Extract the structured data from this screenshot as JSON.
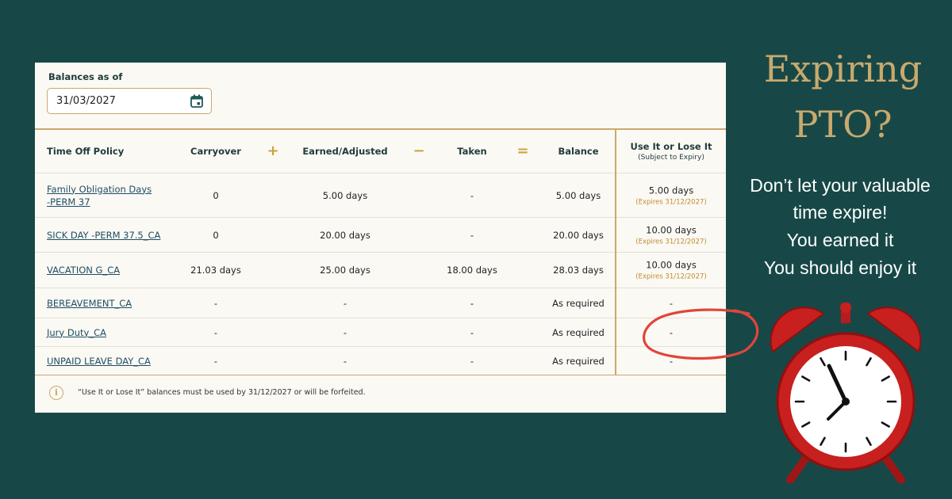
{
  "panel": {
    "balances_label": "Balances as of",
    "date_value": "31/03/2027",
    "columns": {
      "policy": "Time Off Policy",
      "carryover": "Carryover",
      "plus": "+",
      "earned": "Earned/Adjusted",
      "minus": "−",
      "taken": "Taken",
      "equals": "=",
      "balance": "Balance",
      "use_title": "Use It or Lose It",
      "use_sub": "(Subject to Expiry)"
    },
    "rows": [
      {
        "policy_l1": "Family Obligation Days",
        "policy_l2": "-PERM 37",
        "carryover": "0",
        "earned": "5.00 days",
        "taken": "-",
        "balance": "5.00 days",
        "use": "5.00 days",
        "expires": "(Expires 31/12/2027)"
      },
      {
        "policy_l1": "SICK DAY -PERM 37.5_CA",
        "policy_l2": "",
        "carryover": "0",
        "earned": "20.00 days",
        "taken": "-",
        "balance": "20.00 days",
        "use": "10.00 days",
        "expires": "(Expires 31/12/2027)"
      },
      {
        "policy_l1": "VACATION G_CA",
        "policy_l2": "",
        "carryover": "21.03 days",
        "earned": "25.00 days",
        "taken": "18.00 days",
        "balance": "28.03 days",
        "use": "10.00 days",
        "expires": "(Expires 31/12/2027)"
      },
      {
        "policy_l1": "BEREAVEMENT_CA",
        "policy_l2": "",
        "carryover": "-",
        "earned": "-",
        "taken": "-",
        "balance": "As required",
        "use": "-",
        "expires": ""
      },
      {
        "policy_l1": "Jury Duty_CA",
        "policy_l2": "",
        "carryover": "-",
        "earned": "-",
        "taken": "-",
        "balance": "As required",
        "use": "-",
        "expires": ""
      },
      {
        "policy_l1": "UNPAID LEAVE DAY_CA",
        "policy_l2": "",
        "carryover": "-",
        "earned": "-",
        "taken": "-",
        "balance": "As required",
        "use": "-",
        "expires": ""
      }
    ],
    "info_glyph": "i",
    "footer": "“Use It or Lose It” balances must be used by 31/12/2027 or will be forfeited."
  },
  "promo": {
    "headline_l1": "Expiring",
    "headline_l2": "PTO?",
    "sub_l1": "Don’t let your valuable",
    "sub_l2": "time expire!",
    "sub_l3": "You earned it",
    "sub_l4": "You should enjoy it"
  },
  "icons": {
    "date_picker": "calendar-icon",
    "info": "info-icon",
    "clock": "alarm-clock-icon"
  },
  "colors": {
    "background": "#174847",
    "gold": "#c9a96e",
    "circle": "#e0453a"
  }
}
